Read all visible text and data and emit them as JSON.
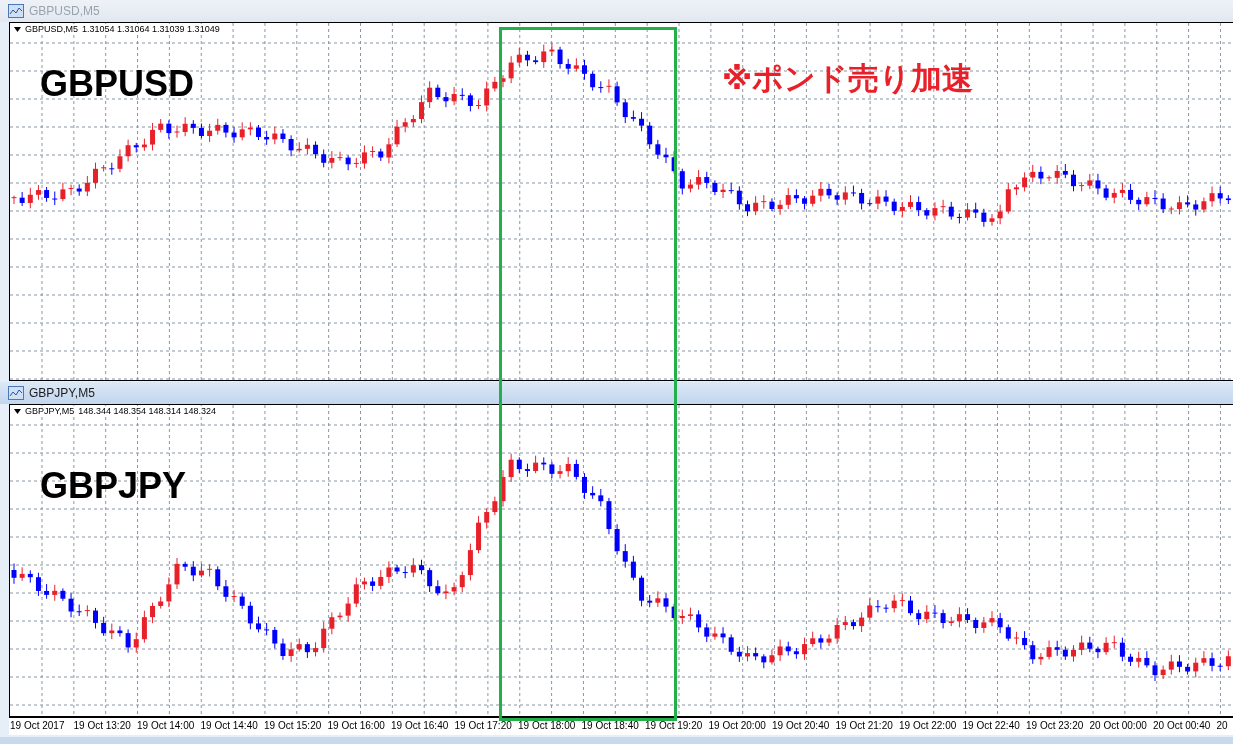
{
  "windows": [
    {
      "title": "GBPUSD,M5",
      "active": false,
      "symbol": "GBPUSD,M5",
      "prices": "1.31054 1.31064 1.31039 1.31049",
      "label": "GBPUSD"
    },
    {
      "title": "GBPJPY,M5",
      "active": true,
      "symbol": "GBPJPY,M5",
      "prices": "148.344 148.354 148.314 148.324",
      "label": "GBPJPY"
    }
  ],
  "x_axis": [
    "19 Oct 2017",
    "19 Oct 13:20",
    "19 Oct 14:00",
    "19 Oct 14:40",
    "19 Oct 15:20",
    "19 Oct 16:00",
    "19 Oct 16:40",
    "19 Oct 17:20",
    "19 Oct 18:00",
    "19 Oct 18:40",
    "19 Oct 19:20",
    "19 Oct 20:00",
    "19 Oct 20:40",
    "19 Oct 21:20",
    "19 Oct 22:00",
    "19 Oct 22:40",
    "19 Oct 23:20",
    "20 Oct 00:00",
    "20 Oct 00:40",
    "20"
  ],
  "annotation": "※ポンド売り加速"
}
